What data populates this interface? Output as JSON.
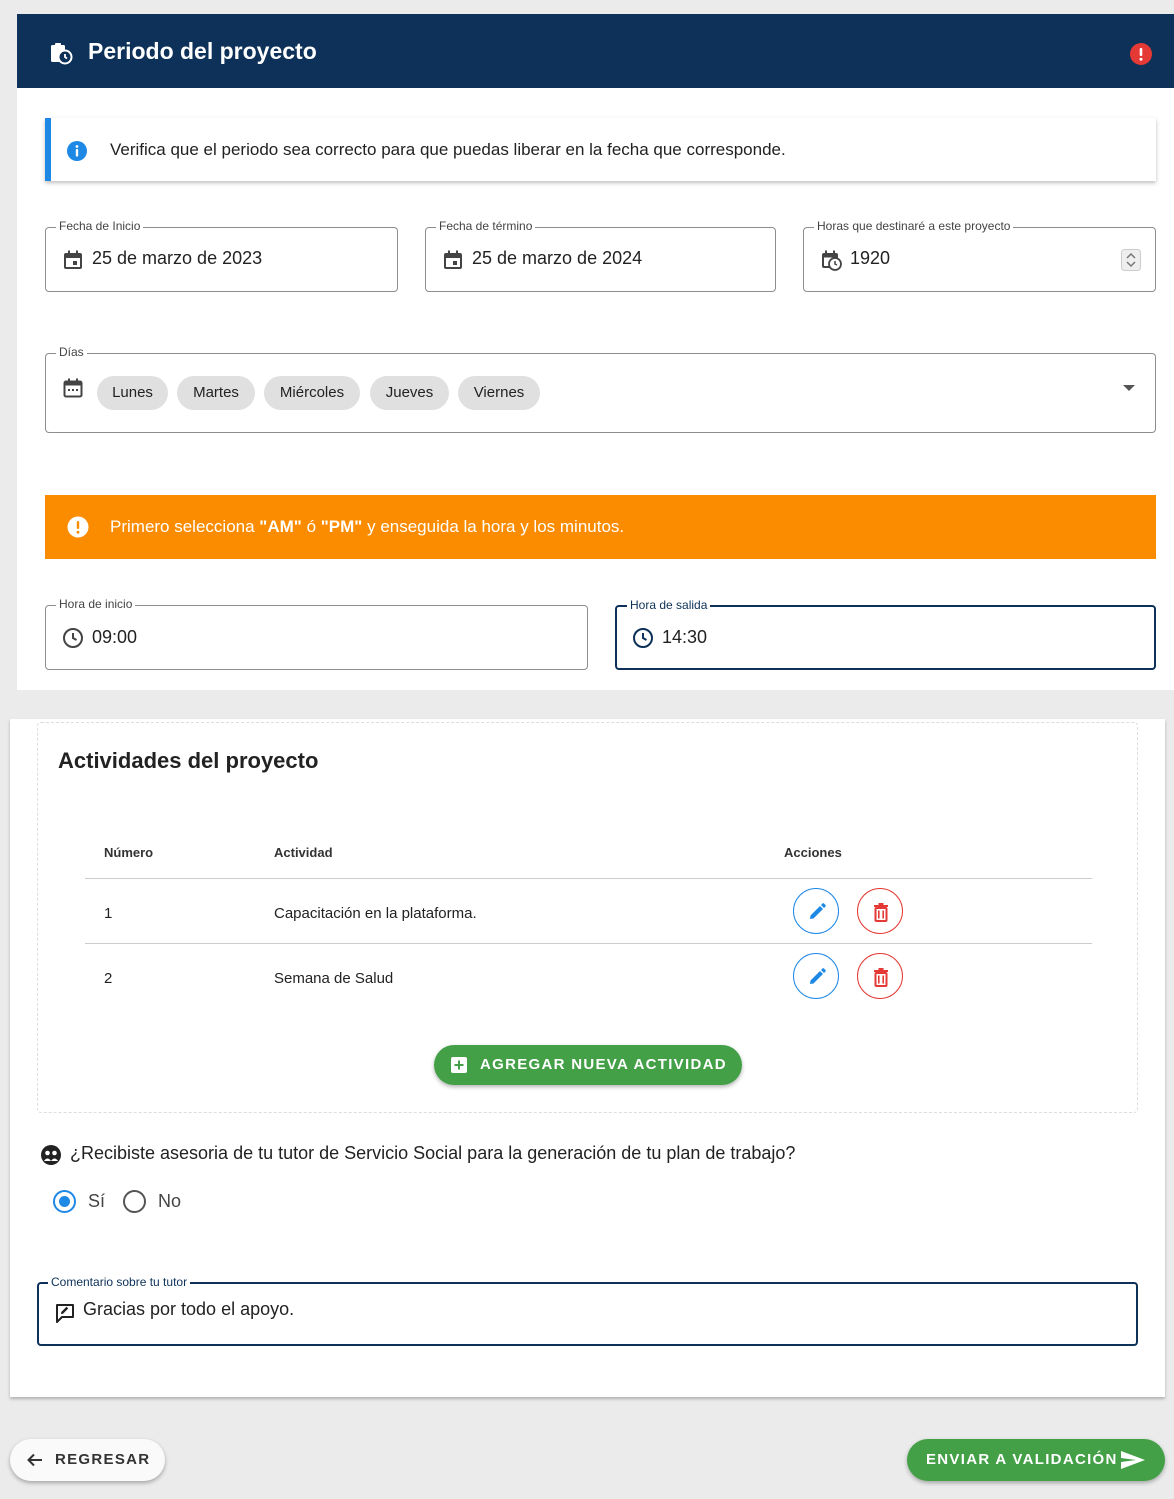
{
  "period": {
    "title": "Periodo del proyecto",
    "info_text": "Verifica que el periodo sea correcto para que puedas liberar en la fecha que corresponde.",
    "start_date": {
      "label": "Fecha de Inicio",
      "value": "25 de marzo de 2023"
    },
    "end_date": {
      "label": "Fecha de término",
      "value": "25 de marzo de 2024"
    },
    "hours": {
      "label": "Horas que destinaré a este proyecto",
      "value": "1920"
    },
    "days": {
      "label": "Días",
      "chips": [
        "Lunes",
        "Martes",
        "Miércoles",
        "Jueves",
        "Viernes"
      ]
    },
    "warning": {
      "pre": "Primero selecciona ",
      "am": "\"AM\"",
      "mid": " ó ",
      "pm": "\"PM\"",
      "post": " y enseguida la hora y los minutos."
    },
    "start_time": {
      "label": "Hora de inicio",
      "value": "09:00"
    },
    "end_time": {
      "label": "Hora de salida",
      "value": "14:30"
    }
  },
  "activities": {
    "title": "Actividades del proyecto",
    "columns": {
      "number": "Número",
      "activity": "Actividad",
      "actions": "Acciones"
    },
    "rows": [
      {
        "number": "1",
        "activity": "Capacitación en la plataforma."
      },
      {
        "number": "2",
        "activity": "Semana de Salud"
      }
    ],
    "add_label": "AGREGAR NUEVA ACTIVIDAD"
  },
  "tutor": {
    "question": "¿Recibiste asesoria de tu tutor de Servicio Social para la generación de tu plan de trabajo?",
    "yes_label": "Sí",
    "no_label": "No",
    "selected": "Sí",
    "comment_label": "Comentario sobre tu tutor",
    "comment_value": "Gracias por todo el apoyo."
  },
  "footer": {
    "back_label": "REGRESAR",
    "send_label": "ENVIAR A VALIDACIÓN"
  },
  "colors": {
    "header_bg": "#0d3158",
    "info_accent": "#1e88e5",
    "warning_bg": "#fb8c00",
    "primary_green": "#43a047",
    "delete_red": "#e53935",
    "alert_red": "#e53935"
  }
}
